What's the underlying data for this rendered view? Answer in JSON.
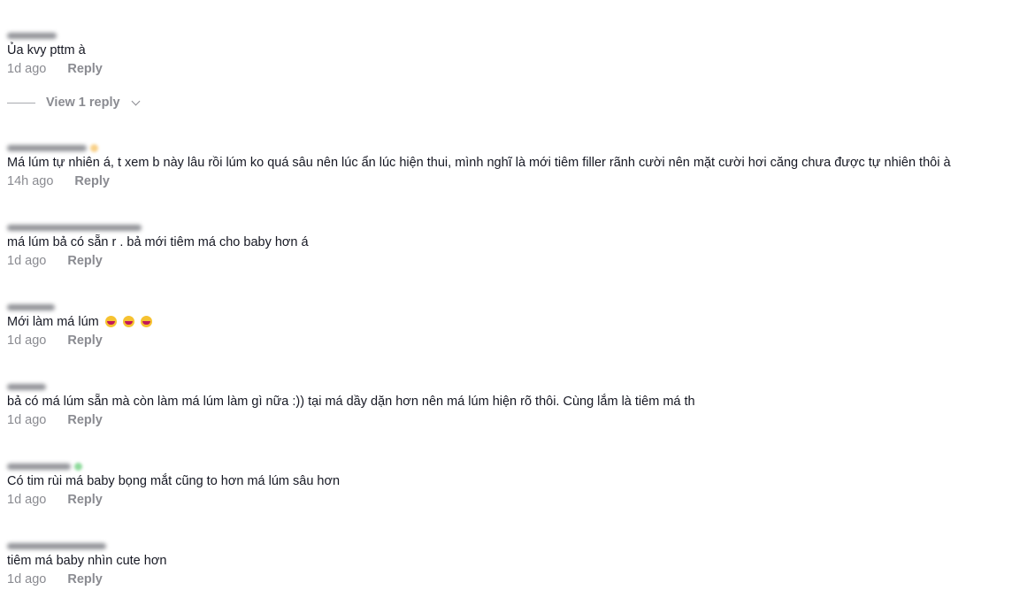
{
  "comments": [
    {
      "text": "Ủa kvy pttm à",
      "time": "1d ago",
      "reply_label": "Reply"
    },
    {
      "text": "Má lúm tự nhiên á, t xem b này lâu rồi lúm ko quá sâu nên lúc ẩn lúc hiện thui, mình nghĩ là mới tiêm filler rãnh cười nên mặt cười hơi căng chưa được tự nhiên thôi à",
      "time": "14h ago",
      "reply_label": "Reply",
      "badge_color": "#f7c873"
    },
    {
      "text": "má lúm bả có sẵn r . bả mới tiêm má cho baby hơn á",
      "time": "1d ago",
      "reply_label": "Reply"
    },
    {
      "text": "Mới làm má lúm",
      "time": "1d ago",
      "reply_label": "Reply",
      "emoji_icon": "laughing-face-emoji"
    },
    {
      "text": "bả có má lúm sẵn mà còn làm má lúm làm gì nữa :)) tại má dầy dặn hơn nên má lúm hiện rõ thôi. Cùng lắm là tiêm má th",
      "time": "1d ago",
      "reply_label": "Reply"
    },
    {
      "text": "Có tim rùi má baby bọng mắt cũng to hơn má lúm sâu hơn",
      "time": "1d ago",
      "reply_label": "Reply",
      "badge_color": "#7ad38a"
    },
    {
      "text": "tiêm má baby nhìn cute hơn",
      "time": "1d ago",
      "reply_label": "Reply"
    }
  ],
  "view_replies": {
    "label": "View 1 reply"
  }
}
